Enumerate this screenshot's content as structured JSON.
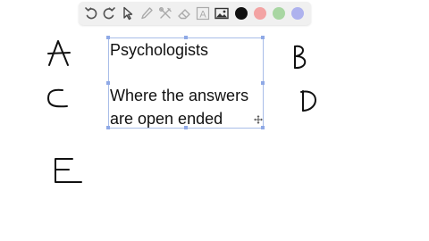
{
  "toolbar": {
    "tools": [
      {
        "icon": "undo-icon"
      },
      {
        "icon": "redo-icon"
      },
      {
        "icon": "select-pointer-icon"
      },
      {
        "icon": "pen-icon"
      },
      {
        "icon": "tools-icon"
      },
      {
        "icon": "eraser-icon"
      },
      {
        "icon": "text-tool-icon",
        "label": "A"
      },
      {
        "icon": "image-icon"
      }
    ],
    "colors": [
      "#111111",
      "#f3a3a3",
      "#a8d6a2",
      "#aeb2ee"
    ],
    "accent": "#a9bde8"
  },
  "text_box": {
    "lines": [
      "Psychologists",
      "Where the answers",
      "are open ended"
    ]
  },
  "handwritten_letters": [
    "A",
    "B",
    "C",
    "D",
    "E"
  ]
}
